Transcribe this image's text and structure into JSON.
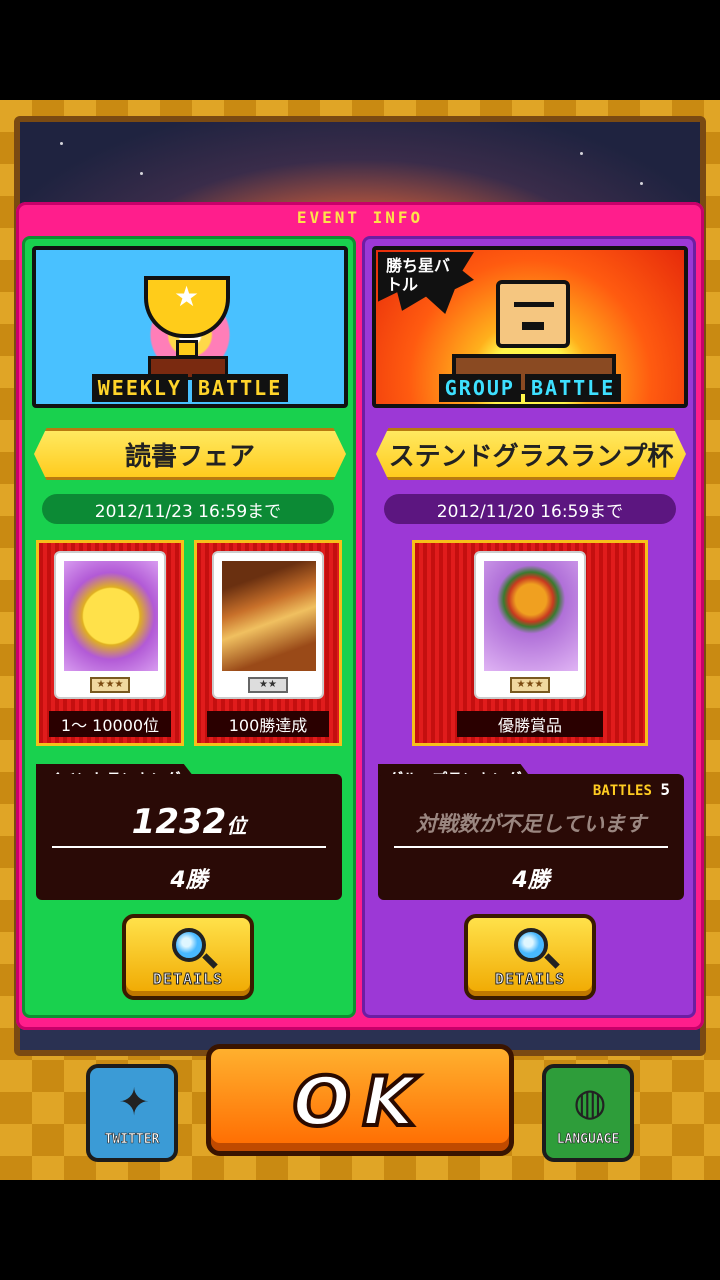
{
  "panel": {
    "title": "EVENT INFO"
  },
  "weekly": {
    "banner_word1": "WEEKLY",
    "banner_word2": "BATTLE",
    "event_name": "読書フェア",
    "deadline": "2012/11/23 16:59まで",
    "rewards": [
      {
        "caption": "1〜 10000位",
        "rarity": "★★★"
      },
      {
        "caption": "100勝達成",
        "rarity": "★★"
      }
    ],
    "ranking": {
      "tab": "イベントランキング",
      "rank_value": "1232",
      "rank_unit": "位",
      "wins": "4勝"
    },
    "details_label": "DETAILS"
  },
  "group": {
    "badge": "勝ち星バトル",
    "banner_word1": "GROUP",
    "banner_word2": "BATTLE",
    "event_name": "ステンドグラスランプ杯",
    "deadline": "2012/11/20 16:59まで",
    "rewards": [
      {
        "caption": "優勝賞品",
        "rarity": "★★★"
      }
    ],
    "ranking": {
      "tab": "グループランキング",
      "battles_label": "BATTLES",
      "battles_value": "5",
      "note": "対戦数が不足しています",
      "wins": "4勝"
    },
    "details_label": "DETAILS"
  },
  "bottom": {
    "twitter_label": "TWITTER",
    "ok_label": "OK",
    "language_label": "LANGUAGE"
  },
  "colors": {
    "panel": "#ff1e8c",
    "weekly_bg": "#19d14e",
    "group_bg": "#9c38d6",
    "ribbon": "#ffd84a",
    "ok_button": "#ff8a10"
  },
  "icons": [
    "trophy-icon",
    "magnifier-icon",
    "twitter-bird-icon",
    "globe-icon"
  ]
}
